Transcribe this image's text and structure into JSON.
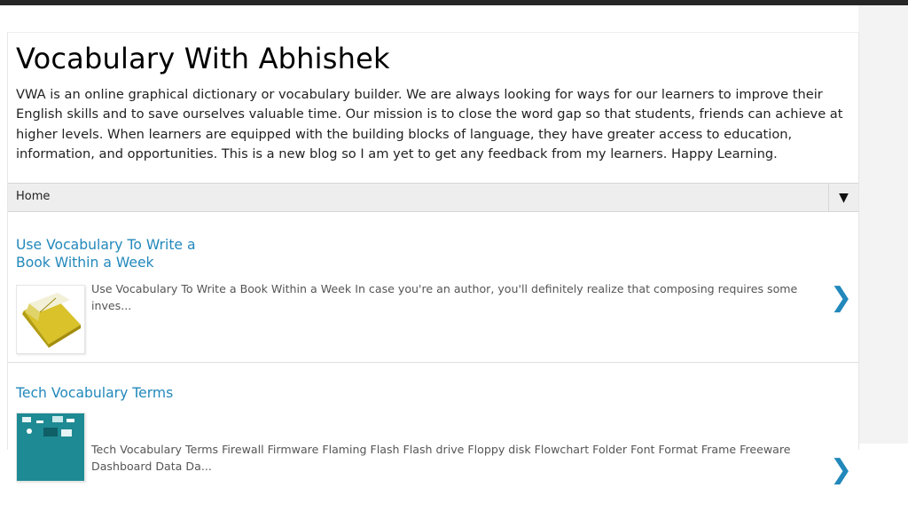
{
  "blog": {
    "title": "Vocabulary With Abhishek",
    "description": "VWA is an online graphical dictionary or vocabulary builder. We are always looking for ways for our learners to improve their English skills and to save ourselves valuable time. Our mission is to close the word gap so that students, friends can achieve at higher levels. When learners are equipped with the building blocks of language, they have greater access to education, information, and opportunities. This is a new blog so I am yet to get any feedback from my learners. Happy Learning."
  },
  "nav": {
    "current": "Home",
    "toggle_symbol": "▼"
  },
  "posts": [
    {
      "title": "Use Vocabulary To Write a Book Within a Week",
      "snippet": "Use Vocabulary To Write a Book Within a Week  In case you're an author, you'll definitely realize that composing requires some inves...",
      "thumbnail_icon": "yellow-book-icon",
      "arrow": "❯"
    },
    {
      "title": "Tech Vocabulary Terms",
      "snippet": "Tech Vocabulary Terms  Firewall Firmware Flaming Flash Flash drive Floppy disk Flowchart Folder Font Format Frame Freeware Dashboard Data Da...",
      "thumbnail_icon": "tech-collage-icon",
      "arrow": "❯"
    }
  ],
  "colors": {
    "link": "#2288bb",
    "nav_bg": "#eeeeee",
    "top_bar": "#262626",
    "snippet_text": "#555555"
  }
}
